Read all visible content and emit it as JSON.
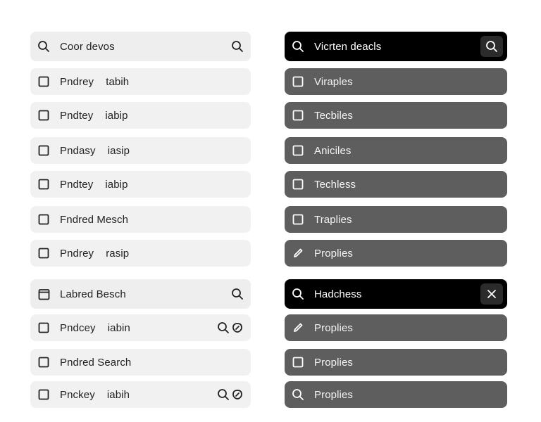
{
  "left_panel": {
    "rows": [
      {
        "label": "Coor devos",
        "lead_icon": "search-icon",
        "tail_icons": [
          "search-icon"
        ],
        "kind": "search"
      },
      {
        "label": "Pndrey    tabih",
        "lead_icon": "checkbox-icon",
        "tail_icons": []
      },
      {
        "label": "Pndtey    iabip",
        "lead_icon": "checkbox-icon",
        "tail_icons": []
      },
      {
        "label": "Pndasy    iasip",
        "lead_icon": "checkbox-icon",
        "tail_icons": []
      },
      {
        "label": "Pndtey    iabip",
        "lead_icon": "checkbox-icon",
        "tail_icons": []
      },
      {
        "label": "Fndred Mesch",
        "lead_icon": "checkbox-icon",
        "tail_icons": []
      },
      {
        "label": "Pndrey    rasip",
        "lead_icon": "checkbox-icon",
        "tail_icons": []
      },
      {
        "label": "Labred Besch",
        "lead_icon": "calendar-icon",
        "tail_icons": [
          "search-icon"
        ],
        "kind": "search"
      },
      {
        "label": "Pndcey    iabin",
        "lead_icon": "checkbox-icon",
        "tail_icons": [
          "search-icon",
          "tag-icon"
        ]
      },
      {
        "label": "Pndred Search",
        "lead_icon": "checkbox-icon",
        "tail_icons": []
      },
      {
        "label": "Pnckey    iabih",
        "lead_icon": "checkbox-icon",
        "tail_icons": [
          "search-icon",
          "tag-icon"
        ]
      }
    ]
  },
  "right_panel": {
    "rows": [
      {
        "label": "Vicrten deacls",
        "lead_icon": "search-icon",
        "button_icon": "search-icon",
        "kind": "search"
      },
      {
        "label": "Viraples",
        "lead_icon": "checkbox-icon"
      },
      {
        "label": "Tecbiles",
        "lead_icon": "checkbox-icon"
      },
      {
        "label": "Aniciles",
        "lead_icon": "checkbox-icon"
      },
      {
        "label": "Techless",
        "lead_icon": "checkbox-icon"
      },
      {
        "label": "Traplies",
        "lead_icon": "checkbox-icon"
      },
      {
        "label": "Proplies",
        "lead_icon": "pencil-icon"
      },
      {
        "label": "Hadchess",
        "lead_icon": "search-icon",
        "button_icon": "close-icon",
        "kind": "search"
      },
      {
        "label": "Proplies",
        "lead_icon": "pencil-icon"
      },
      {
        "label": "Proplies",
        "lead_icon": "checkbox-icon"
      },
      {
        "label": "Proplies",
        "lead_icon": "search-icon"
      }
    ]
  },
  "colors": {
    "light_row": "#f1f1f1",
    "dark_row": "#5e5e5e",
    "dark_search": "#000000"
  }
}
